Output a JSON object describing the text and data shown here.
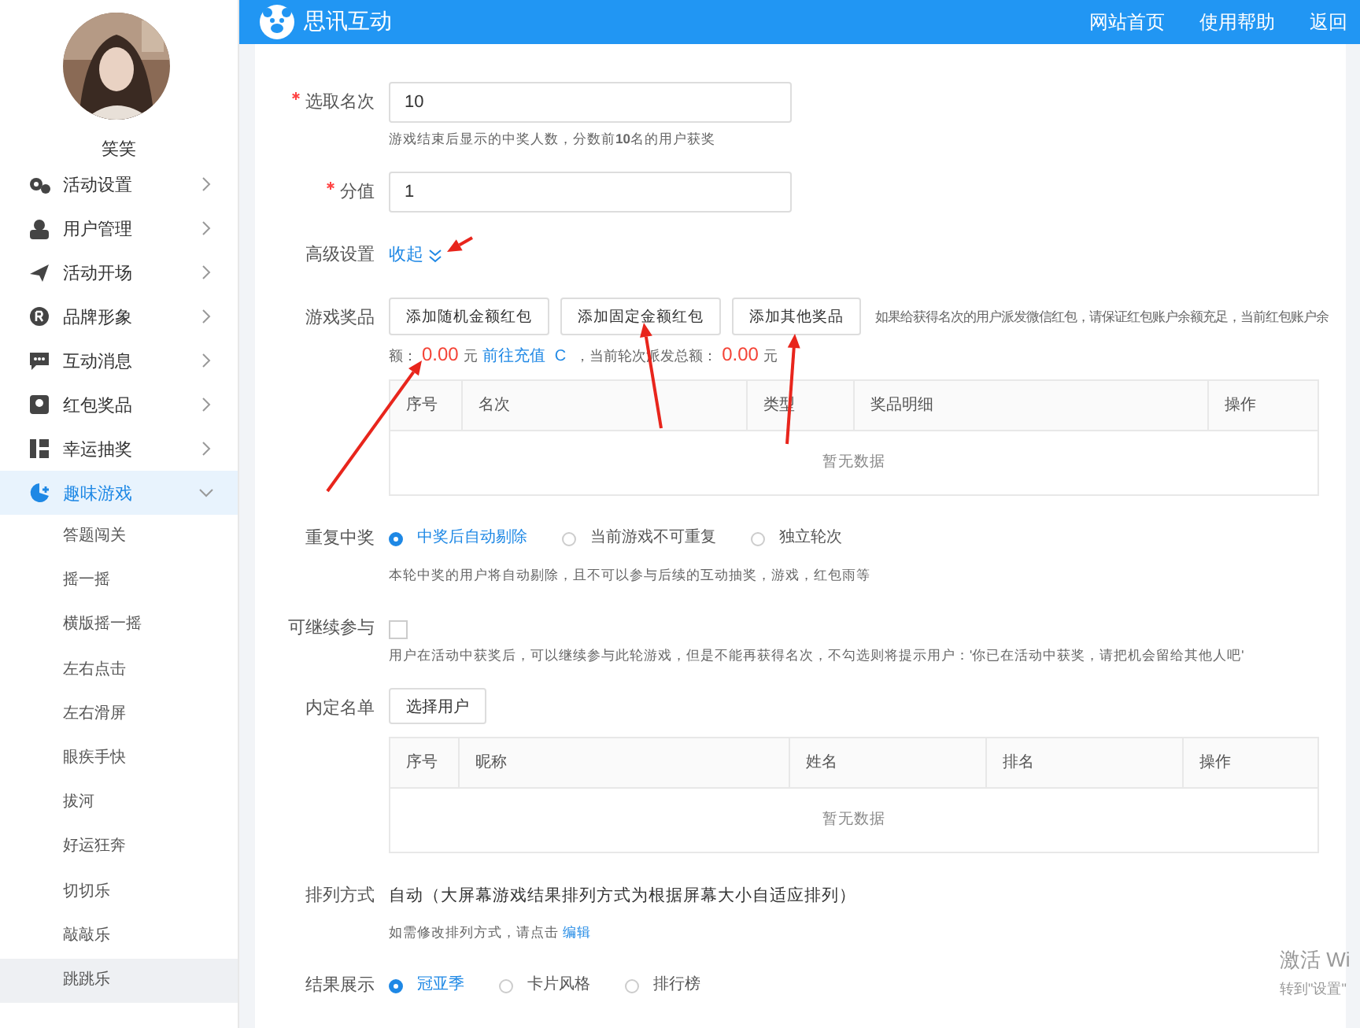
{
  "header": {
    "logo_text": "思讯互动",
    "nav": [
      {
        "label": "网站首页"
      },
      {
        "label": "使用帮助"
      },
      {
        "label": "返回"
      }
    ]
  },
  "sidebar": {
    "user_name": "笑笑",
    "menu": [
      {
        "label": "活动设置",
        "selected": false,
        "expanded": false
      },
      {
        "label": "用户管理",
        "selected": false,
        "expanded": false
      },
      {
        "label": "活动开场",
        "selected": false,
        "expanded": false
      },
      {
        "label": "品牌形象",
        "selected": false,
        "expanded": false
      },
      {
        "label": "互动消息",
        "selected": false,
        "expanded": false
      },
      {
        "label": "红包奖品",
        "selected": false,
        "expanded": false
      },
      {
        "label": "幸运抽奖",
        "selected": false,
        "expanded": false
      },
      {
        "label": "趣味游戏",
        "selected": true,
        "expanded": true,
        "children": [
          {
            "label": "答题闯关",
            "selected": false
          },
          {
            "label": "摇一摇",
            "selected": false
          },
          {
            "label": "横版摇一摇",
            "selected": false
          },
          {
            "label": "左右点击",
            "selected": false
          },
          {
            "label": "左右滑屏",
            "selected": false
          },
          {
            "label": "眼疾手快",
            "selected": false
          },
          {
            "label": "拔河",
            "selected": false
          },
          {
            "label": "好运狂奔",
            "selected": false
          },
          {
            "label": "切切乐",
            "selected": false
          },
          {
            "label": "敲敲乐",
            "selected": false
          },
          {
            "label": "跳跳乐",
            "selected": true
          }
        ]
      }
    ]
  },
  "form": {
    "rank_count": {
      "label": "选取名次",
      "required": true,
      "value": "10",
      "hint": "游戏结束后显示的中奖人数，分数前**10**名的用户获奖"
    },
    "score": {
      "label": "分值",
      "required": true,
      "value": "1"
    },
    "advanced": {
      "label": "高级设置",
      "link": "收起",
      "expanded": true
    },
    "prizes": {
      "label": "游戏奖品",
      "buttons": [
        "添加随机金额红包",
        "添加固定金额红包",
        "添加其他奖品"
      ],
      "note": "如果给获得名次的用户派发微信红包，请保证红包账户余额充足，当前红包账户余",
      "balance_label": "额：",
      "balance": "0.00",
      "balance_unit": "元",
      "recharge": "前往充值",
      "refresh": "C",
      "total_label": "，当前轮次派发总额：",
      "total": "0.00",
      "total_unit": "元",
      "table": {
        "columns": [
          "序号",
          "名次",
          "类型",
          "奖品明细",
          "操作"
        ],
        "empty": "暂无数据"
      }
    },
    "repeat": {
      "label": "重复中奖",
      "options": [
        {
          "label": "中奖后自动剔除",
          "selected": true
        },
        {
          "label": "当前游戏不可重复",
          "selected": false
        },
        {
          "label": "独立轮次",
          "selected": false
        }
      ],
      "hint": "本轮中奖的用户将自动剔除，且不可以参与后续的互动抽奖，游戏，红包雨等"
    },
    "continue": {
      "label": "可继续参与",
      "checked": false,
      "hint": "用户在活动中获奖后，可以继续参与此轮游戏，但是不能再获得名次，不勾选则将提示用户：'你已在活动中获奖，请把机会留给其他人吧'"
    },
    "whitelist": {
      "label": "内定名单",
      "button": "选择用户",
      "table": {
        "columns": [
          "序号",
          "昵称",
          "姓名",
          "排名",
          "操作"
        ],
        "empty": "暂无数据"
      }
    },
    "sort": {
      "label": "排列方式",
      "value": "自动（大屏幕游戏结果排列方式为根据屏幕大小自适应排列）",
      "hint": "如需修改排列方式，请点击",
      "link": "编辑"
    },
    "result": {
      "label": "结果展示",
      "options": [
        {
          "label": "冠亚季",
          "selected": true
        },
        {
          "label": "卡片风格",
          "selected": false
        },
        {
          "label": "排行榜",
          "selected": false
        }
      ]
    }
  },
  "os_overlay": {
    "line1": "激活 Wi",
    "line2": "转到\"设置\""
  }
}
